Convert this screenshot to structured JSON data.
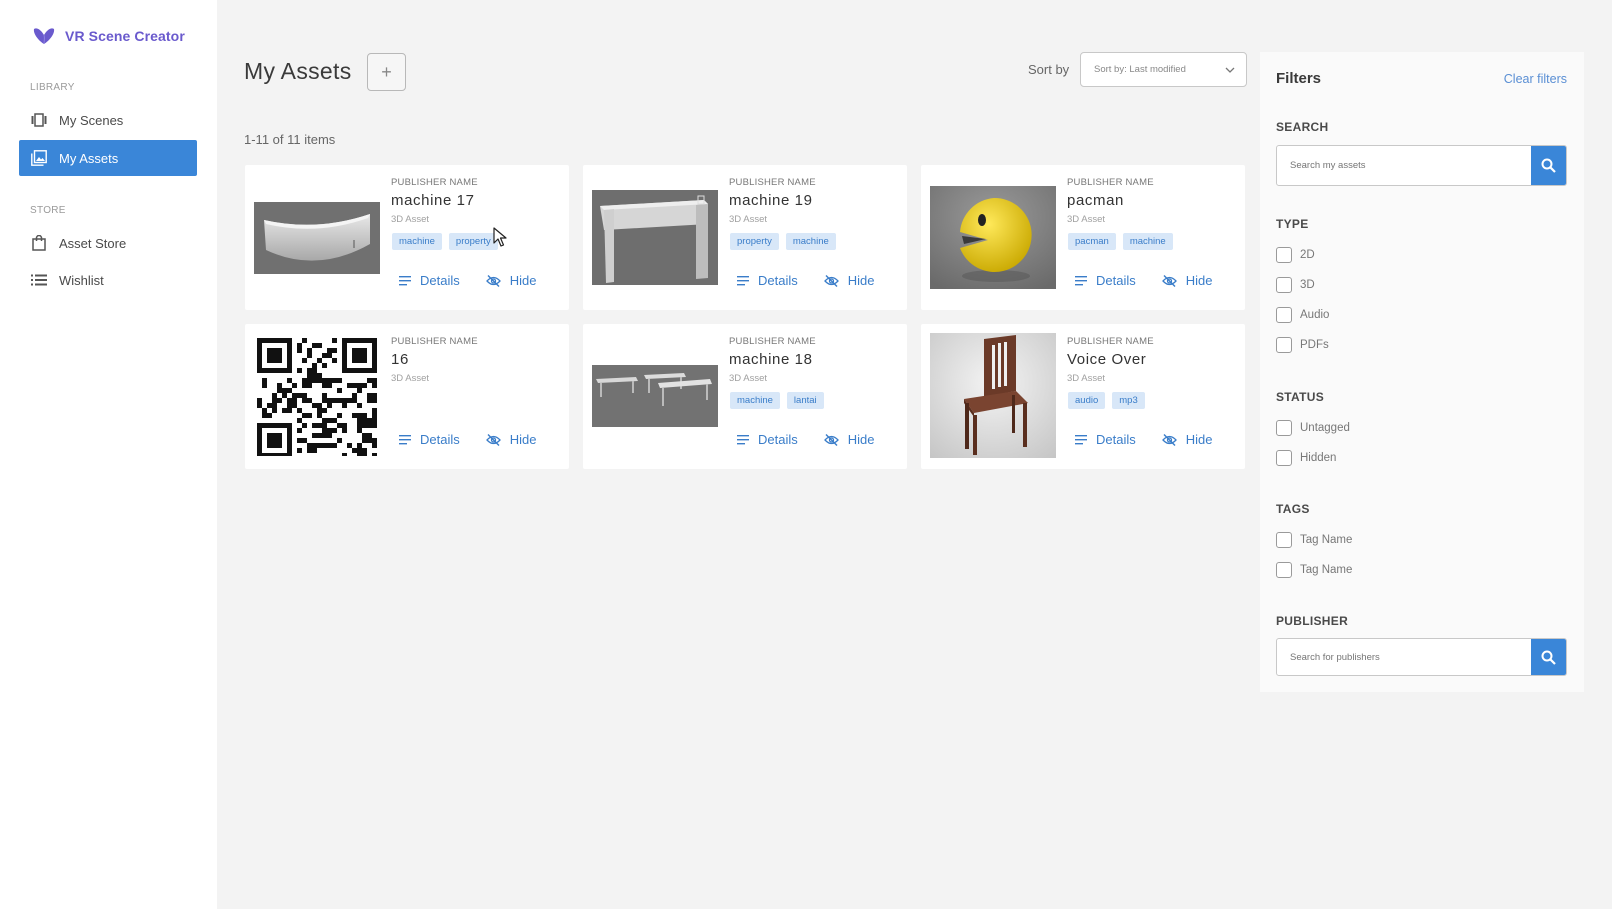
{
  "app": {
    "title": "VR Scene Creator"
  },
  "sidebar": {
    "library_label": "LIBRARY",
    "store_label": "STORE",
    "items": [
      {
        "label": "My Scenes",
        "icon": "scenes-icon",
        "active": false
      },
      {
        "label": "My Assets",
        "icon": "image-gallery-icon",
        "active": true
      },
      {
        "label": "Asset Store",
        "icon": "shopping-bag-icon",
        "active": false
      },
      {
        "label": "Wishlist",
        "icon": "list-icon",
        "active": false
      }
    ]
  },
  "header": {
    "title": "My Assets",
    "add_label": "+",
    "sort_label": "Sort by",
    "sort_value": "Sort by: Last modified",
    "items_count": "1-11 of 11 items"
  },
  "assets": [
    {
      "publisher": "PUBLISHER NAME",
      "name": "machine 17",
      "type": "3D Asset",
      "tags": [
        "machine",
        "property"
      ],
      "details": "Details",
      "hide": "Hide",
      "thumb": "curved-counter"
    },
    {
      "publisher": "PUBLISHER NAME",
      "name": "machine 19",
      "type": "3D Asset",
      "tags": [
        "property",
        "machine"
      ],
      "details": "Details",
      "hide": "Hide",
      "thumb": "gate"
    },
    {
      "publisher": "PUBLISHER NAME",
      "name": "pacman",
      "type": "3D Asset",
      "tags": [
        "pacman",
        "machine"
      ],
      "details": "Details",
      "hide": "Hide",
      "thumb": "pacman"
    },
    {
      "publisher": "PUBLISHER NAME",
      "name": "16",
      "type": "3D Asset",
      "tags": [],
      "details": "Details",
      "hide": "Hide",
      "thumb": "qr-code"
    },
    {
      "publisher": "PUBLISHER NAME",
      "name": "machine 18",
      "type": "3D Asset",
      "tags": [
        "machine",
        "lantai"
      ],
      "details": "Details",
      "hide": "Hide",
      "thumb": "tables"
    },
    {
      "publisher": "PUBLISHER NAME",
      "name": "Voice Over",
      "type": "3D Asset",
      "tags": [
        "audio",
        "mp3"
      ],
      "details": "Details",
      "hide": "Hide",
      "thumb": "chair"
    }
  ],
  "filters": {
    "title": "Filters",
    "clear": "Clear filters",
    "search_head": "SEARCH",
    "search_placeholder": "Search my assets",
    "type_head": "TYPE",
    "types": [
      "2D",
      "3D",
      "Audio",
      "PDFs"
    ],
    "status_head": "STATUS",
    "statuses": [
      "Untagged",
      "Hidden"
    ],
    "tags_head": "TAGS",
    "tags": [
      "Tag Name",
      "Tag Name"
    ],
    "publisher_head": "PUBLISHER",
    "publisher_placeholder": "Search for publishers"
  },
  "colors": {
    "accent": "#3a86d8",
    "brand": "#6a5acd",
    "tag_bg": "#d8e7f8",
    "link": "#3a7dc9"
  }
}
